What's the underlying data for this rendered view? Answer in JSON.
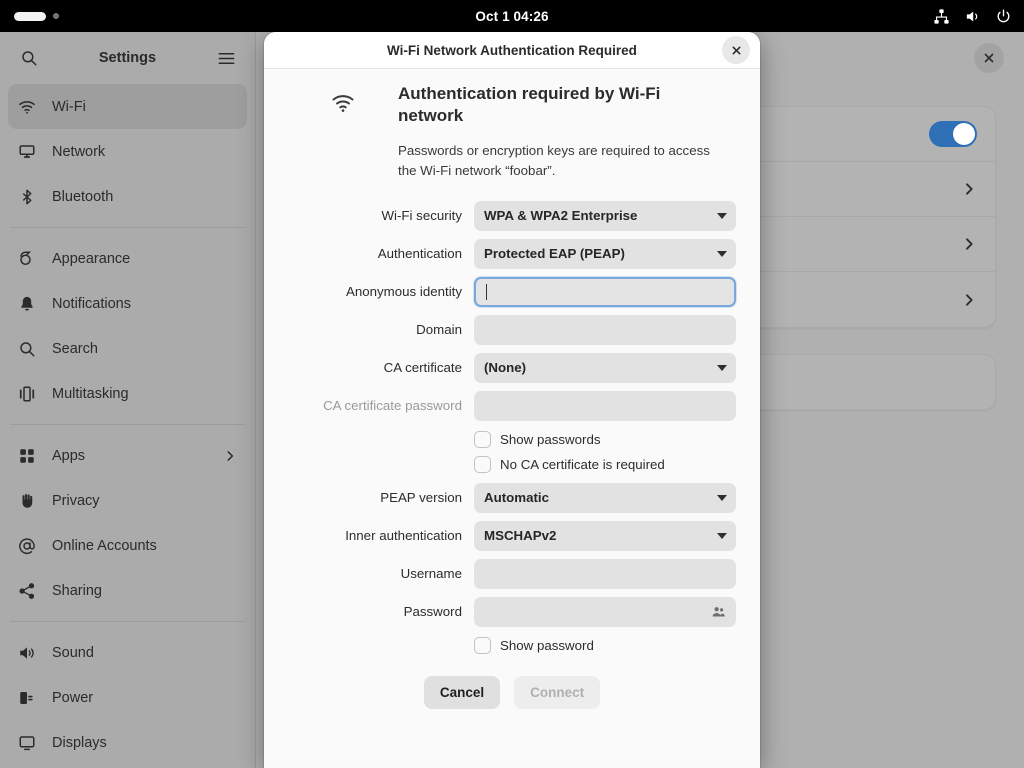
{
  "topbar": {
    "clock": "Oct 1  04:26",
    "tray": [
      {
        "name": "network-wired-icon"
      },
      {
        "name": "volume-icon"
      },
      {
        "name": "power-icon"
      }
    ],
    "workspace_indicators": 2
  },
  "settings_window": {
    "sidebar": {
      "title": "Settings",
      "search_icon": "search-icon",
      "menu_icon": "hamburger-menu-icon",
      "groups": [
        {
          "items": [
            {
              "label": "Wi-Fi",
              "icon": "wifi-icon",
              "active": true,
              "chevron": false
            },
            {
              "label": "Network",
              "icon": "network-icon",
              "active": false,
              "chevron": false
            },
            {
              "label": "Bluetooth",
              "icon": "bluetooth-icon",
              "active": false,
              "chevron": false
            }
          ]
        },
        {
          "items": [
            {
              "label": "Appearance",
              "icon": "appearance-icon",
              "active": false,
              "chevron": false
            },
            {
              "label": "Notifications",
              "icon": "bell-icon",
              "active": false,
              "chevron": false
            },
            {
              "label": "Search",
              "icon": "search-icon",
              "active": false,
              "chevron": false
            },
            {
              "label": "Multitasking",
              "icon": "multitasking-icon",
              "active": false,
              "chevron": false
            }
          ]
        },
        {
          "items": [
            {
              "label": "Apps",
              "icon": "apps-grid-icon",
              "active": false,
              "chevron": true
            },
            {
              "label": "Privacy",
              "icon": "hand-icon",
              "active": false,
              "chevron": false
            },
            {
              "label": "Online Accounts",
              "icon": "at-sign-icon",
              "active": false,
              "chevron": false
            },
            {
              "label": "Sharing",
              "icon": "share-icon",
              "active": false,
              "chevron": false
            }
          ]
        },
        {
          "items": [
            {
              "label": "Sound",
              "icon": "speaker-icon",
              "active": false,
              "chevron": false
            },
            {
              "label": "Power",
              "icon": "power-plug-icon",
              "active": false,
              "chevron": false
            },
            {
              "label": "Displays",
              "icon": "display-icon",
              "active": false,
              "chevron": false
            }
          ]
        }
      ]
    },
    "content": {
      "close_icon": "close-icon",
      "rows": [
        {
          "name": "wifi-toggle-row",
          "control": "toggle",
          "toggle_on": true
        },
        {
          "name": "network-row-1",
          "control": "chevron"
        },
        {
          "name": "network-row-2",
          "control": "chevron"
        },
        {
          "name": "network-row-3",
          "control": "chevron"
        }
      ]
    }
  },
  "dialog": {
    "title": "Wi-Fi Network Authentication Required",
    "close_icon": "close-icon",
    "wifi_icon": "wifi-icon",
    "heading": "Authentication required by Wi-Fi network",
    "description": "Passwords or encryption keys are required to access the Wi-Fi network “foobar”.",
    "fields": [
      {
        "name": "wifi-security",
        "label": "Wi-Fi security",
        "type": "combo",
        "value": "WPA & WPA2 Enterprise",
        "disabled": false
      },
      {
        "name": "authentication",
        "label": "Authentication",
        "type": "combo",
        "value": "Protected EAP (PEAP)",
        "disabled": false
      },
      {
        "name": "anonymous-identity",
        "label": "Anonymous identity",
        "type": "entry",
        "value": "",
        "focused": true,
        "disabled": false
      },
      {
        "name": "domain",
        "label": "Domain",
        "type": "entry",
        "value": "",
        "focused": false,
        "disabled": false
      },
      {
        "name": "ca-certificate",
        "label": "CA certificate",
        "type": "combo",
        "value": "(None)",
        "disabled": false
      },
      {
        "name": "ca-certificate-password",
        "label": "CA certificate password",
        "type": "entry",
        "value": "",
        "focused": false,
        "disabled": true
      }
    ],
    "checkboxes_upper": [
      {
        "name": "show-passwords",
        "label": "Show passwords",
        "checked": false
      },
      {
        "name": "no-ca-certificate-required",
        "label": "No CA certificate is required",
        "checked": false
      }
    ],
    "fields_lower": [
      {
        "name": "peap-version",
        "label": "PEAP version",
        "type": "combo",
        "value": "Automatic",
        "disabled": false
      },
      {
        "name": "inner-authentication",
        "label": "Inner authentication",
        "type": "combo",
        "value": "MSCHAPv2",
        "disabled": false
      },
      {
        "name": "username",
        "label": "Username",
        "type": "entry",
        "value": "",
        "focused": false,
        "disabled": false
      },
      {
        "name": "password",
        "label": "Password",
        "type": "entry",
        "value": "",
        "focused": false,
        "disabled": false,
        "trailing_icon": "contacts-people-icon"
      }
    ],
    "checkboxes_lower": [
      {
        "name": "show-password",
        "label": "Show password",
        "checked": false
      }
    ],
    "buttons": [
      {
        "name": "cancel-button",
        "label": "Cancel",
        "disabled": false
      },
      {
        "name": "connect-button",
        "label": "Connect",
        "disabled": true
      }
    ]
  },
  "colors": {
    "accent_blue": "#2f6fb5",
    "focus_border": "#7aa8dd",
    "topbar_bg": "#000000",
    "sidebar_bg": "#ababab",
    "dialog_bg": "#fafafa"
  }
}
